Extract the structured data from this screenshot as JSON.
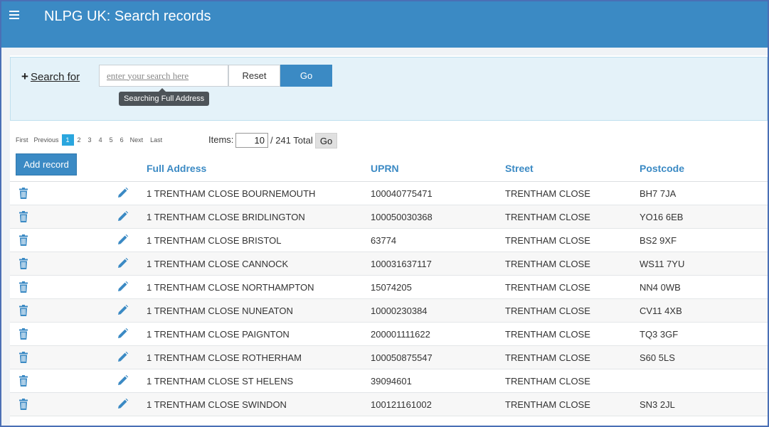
{
  "header": {
    "title": "NLPG UK: Search records",
    "menu_icon": "hamburger-menu-icon"
  },
  "search": {
    "search_for_label": "Search for",
    "plus_icon": "plus-icon",
    "placeholder": "enter your search here",
    "reset_label": "Reset",
    "go_label": "Go",
    "tooltip": "Searching Full Address"
  },
  "pagination": {
    "first": "First",
    "previous": "Previous",
    "pages": [
      "1",
      "2",
      "3",
      "4",
      "5",
      "6"
    ],
    "current_page": "1",
    "next": "Next",
    "last": "Last",
    "items_label": "Items:",
    "items_value": "10",
    "total": "/ 241 Total",
    "go_label": "Go"
  },
  "actions": {
    "add_record": "Add record",
    "delete_icon": "trash-icon",
    "edit_icon": "pencil-icon"
  },
  "table": {
    "columns": [
      "Full Address",
      "UPRN",
      "Street",
      "Postcode"
    ],
    "rows": [
      [
        "1 TRENTHAM CLOSE BOURNEMOUTH",
        "100040775471",
        "TRENTHAM CLOSE",
        "BH7 7JA"
      ],
      [
        "1 TRENTHAM CLOSE BRIDLINGTON",
        "100050030368",
        "TRENTHAM CLOSE",
        "YO16 6EB"
      ],
      [
        "1 TRENTHAM CLOSE BRISTOL",
        "63774",
        "TRENTHAM CLOSE",
        "BS2 9XF"
      ],
      [
        "1 TRENTHAM CLOSE CANNOCK",
        "100031637117",
        "TRENTHAM CLOSE",
        "WS11 7YU"
      ],
      [
        "1 TRENTHAM CLOSE NORTHAMPTON",
        "15074205",
        "TRENTHAM CLOSE",
        "NN4 0WB"
      ],
      [
        "1 TRENTHAM CLOSE NUNEATON",
        "10000230384",
        "TRENTHAM CLOSE",
        "CV11 4XB"
      ],
      [
        "1 TRENTHAM CLOSE PAIGNTON",
        "200001111622",
        "TRENTHAM CLOSE",
        "TQ3 3GF"
      ],
      [
        "1 TRENTHAM CLOSE ROTHERHAM",
        "100050875547",
        "TRENTHAM CLOSE",
        "S60 5LS"
      ],
      [
        "1 TRENTHAM CLOSE ST HELENS",
        "39094601",
        "TRENTHAM CLOSE",
        ""
      ],
      [
        "1 TRENTHAM CLOSE SWINDON",
        "100121161002",
        "TRENTHAM CLOSE",
        "SN3 2JL"
      ]
    ]
  },
  "colors": {
    "brand": "#3b8ac4",
    "panel": "#e4f2f9",
    "active_page": "#2aa6de"
  }
}
